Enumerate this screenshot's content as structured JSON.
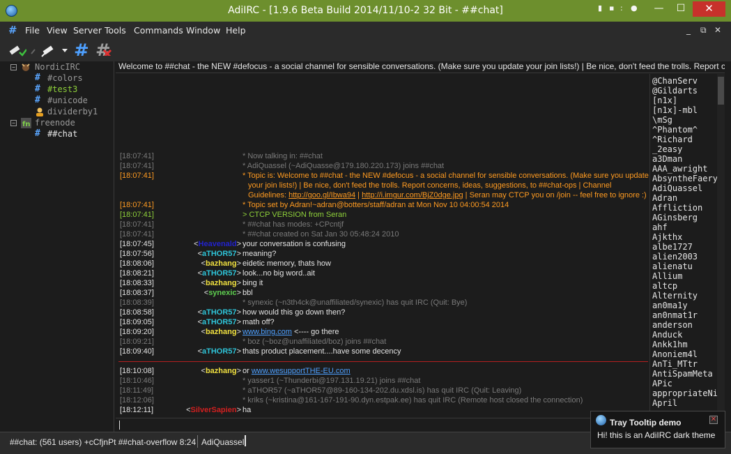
{
  "window": {
    "title": "AdiIRC - [1.9.6 Beta Build 2014/11/10-2 32 Bit - ##chat]",
    "min": "—",
    "max": "☐",
    "close": "✕"
  },
  "menu": [
    "File",
    "View",
    "Server",
    "Tools",
    "Commands",
    "Window",
    "Help"
  ],
  "tree": {
    "servers": [
      {
        "label": "NordicIRC",
        "channels": [
          "#colors",
          "#test3",
          "#unicode"
        ],
        "query": "dividerby1"
      },
      {
        "label": "freenode",
        "channels": [
          "##chat"
        ]
      }
    ]
  },
  "topic": "Welcome to ##chat - the NEW #defocus - a social channel for sensible conversations. (Make sure you update your join lists!) | Be nice, don't feed the trolls. Report concerns, ideas,",
  "chat": [
    {
      "ts": "[18:07:41]",
      "text": "* Now talking in: ##chat"
    },
    {
      "ts": "[18:07:41]",
      "text": "* AdiQuassel (~AdiQuasse@179.180.220.173) joins ##chat"
    },
    {
      "ts": "[18:07:41]",
      "text": "* Topic is: Welcome to ##chat - the NEW #defocus - a social channel for sensible conversations. (Make sure you update"
    },
    {
      "wrap": "your join lists!) | Be nice, don't feed the trolls. Report concerns, ideas, suggestions, to ##chat-ops | Channel"
    },
    {
      "wrap_a": "Guidelines: ",
      "link1": "http://goo.gl/Ibwa94",
      "sep1": " | ",
      "link2": "http://i.imgur.com/BjZ0dge.jpg",
      "wrap_b": " | Seran may CTCP you on /join -- feel free to ignore :)"
    },
    {
      "ts": "[18:07:41]",
      "text": "* Topic set by Adran!~adran@botters/staff/adran at Mon Nov 10 04:00:54 2014"
    },
    {
      "ts": "[18:07:41]",
      "text": "> CTCP VERSION from Seran"
    },
    {
      "ts": "[18:07:41]",
      "text": "* ##chat has modes: +CPcntjf"
    },
    {
      "ts": "[18:07:41]",
      "text": "* ##chat created on Sat Jan 30 05:48:24 2010"
    },
    {
      "ts": "[18:07:45]",
      "nick": "Heavenald",
      "text": "your conversation is confusing"
    },
    {
      "ts": "[18:07:56]",
      "nick": "aTHOR57",
      "text": "meaning?"
    },
    {
      "ts": "[18:08:06]",
      "nick": "bazhang",
      "text": "eidetic memory, thats how"
    },
    {
      "ts": "[18:08:21]",
      "nick": "aTHOR57",
      "text": "look...no big word..ait"
    },
    {
      "ts": "[18:08:33]",
      "nick": "bazhang",
      "text": "bing it"
    },
    {
      "ts": "[18:08:37]",
      "nick": "synexic",
      "text": "bbl"
    },
    {
      "ts": "[18:08:39]",
      "text": "* synexic (~n3th4ck@unaffiliated/synexic) has quit IRC (Quit: Bye)"
    },
    {
      "ts": "[18:08:58]",
      "nick": "aTHOR57",
      "text": "how would this go down then?"
    },
    {
      "ts": "[18:09:05]",
      "nick": "aTHOR57",
      "text": "math off?"
    },
    {
      "ts": "[18:09:20]",
      "nick": "bazhang",
      "link": "www.bing.com",
      "text": " <---- go there"
    },
    {
      "ts": "[18:09:21]",
      "text": "* boz (~boz@unaffiliated/boz) joins ##chat"
    },
    {
      "ts": "[18:09:40]",
      "nick": "aTHOR57",
      "text": "thats product placement....have some decency"
    },
    {
      "ts": "[18:10:08]",
      "nick": "bazhang",
      "text": "or ",
      "link": "www.wesupportTHE-EU.com"
    },
    {
      "ts": "[18:10:46]",
      "text": "* yasser1 (~Thunderbi@197.131.19.21) joins ##chat"
    },
    {
      "ts": "[18:11:49]",
      "text": "* aTHOR57 (~aTHOR57@89-160-134-202.du.xdsl.is) has quit IRC (Quit: Leaving)"
    },
    {
      "ts": "[18:12:06]",
      "text": "* kriks (~kristina@161-167-191-90.dyn.estpak.ee) has quit IRC (Remote host closed the connection)"
    },
    {
      "ts": "[18:12:11]",
      "nick": "SilverSapien",
      "text": "ha"
    }
  ],
  "nicklist": [
    "@ChanServ",
    "@Gildarts",
    "[n1x]",
    "[n1x]-mbl",
    "\\mSg",
    "^Phantom^",
    "^Richard",
    "_2easy",
    "a3Dman",
    "AAA_awright",
    "AbsyntheFaery",
    "AdiQuassel",
    "Adran",
    "Affliction",
    "AGinsberg",
    "ahf",
    "Ajkthx",
    "albe1727",
    "alien2003",
    "alienatu",
    "Allium",
    "altcp",
    "Alternity",
    "an0ma1y",
    "an0nmat1r",
    "anderson",
    "Anduck",
    "Ankk1hm",
    "Anoniem4l",
    "AnTi_MTtr",
    "AntiSpamMeta",
    "APic",
    "appropriateNi",
    "April"
  ],
  "status": {
    "info": "##chat: (561 users) +cCfjnPt ##chat-overflow 8:24",
    "nick": "AdiQuassel"
  },
  "tooltip": {
    "title": "Tray Tooltip demo",
    "body": "Hi! this is an AdiIRC dark theme",
    "close": "✕"
  },
  "colors": {
    "titlebar": "#6d8f2d",
    "timestamp_gray": "#7a7a7a",
    "topic_orange": "#ff9b21",
    "ctcp_green": "#8fd13a",
    "nick_cyan": "#2ec4d8",
    "nick_yellow": "#f0e040",
    "nick_green": "#5fd050",
    "nick_red": "#d02020",
    "nick_blue": "#2222cc"
  },
  "icons": [
    "app-icon",
    "server-icon",
    "channel-hash-icon",
    "query-user-icon",
    "connect-icon",
    "disconnect-icon",
    "join-channel-icon",
    "part-channel-icon",
    "tray-icon"
  ]
}
